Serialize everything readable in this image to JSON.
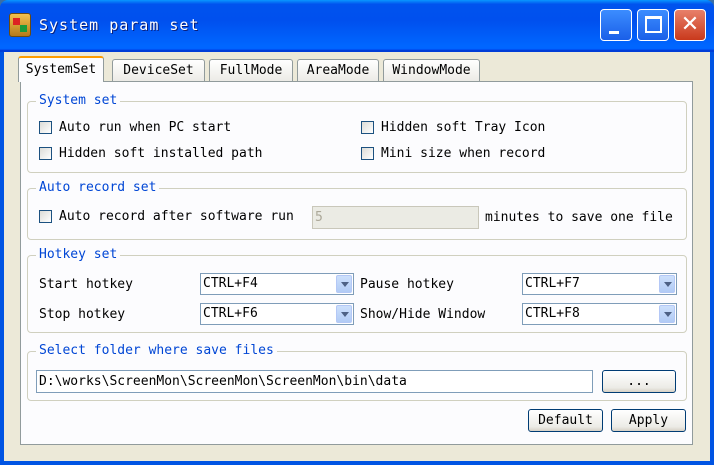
{
  "window": {
    "title": "System param set",
    "controls": {
      "minimize": "minimize",
      "maximize": "maximize",
      "close": "✕"
    }
  },
  "tabs": [
    {
      "label": "SystemSet",
      "active": true
    },
    {
      "label": "DeviceSet",
      "active": false
    },
    {
      "label": "FullMode",
      "active": false
    },
    {
      "label": "AreaMode",
      "active": false
    },
    {
      "label": "WindowMode",
      "active": false
    }
  ],
  "system_set": {
    "label": "System set",
    "auto_run": {
      "label": "Auto run when PC start",
      "checked": false
    },
    "hidden_tray": {
      "label": "Hidden soft Tray Icon",
      "checked": false
    },
    "hidden_path": {
      "label": "Hidden soft installed path",
      "checked": false
    },
    "mini_size": {
      "label": "Mini size when record",
      "checked": false
    }
  },
  "auto_record": {
    "label": "Auto record set",
    "checkbox": {
      "label": "Auto record after software run",
      "checked": false
    },
    "minutes_value": "5",
    "minutes_suffix": "minutes to save one file"
  },
  "hotkey": {
    "label": "Hotkey set",
    "start": {
      "label": "Start hotkey",
      "value": "CTRL+F4"
    },
    "pause": {
      "label": "Pause hotkey",
      "value": "CTRL+F7"
    },
    "stop": {
      "label": "Stop hotkey",
      "value": "CTRL+F6"
    },
    "showhide": {
      "label": "Show/Hide Window",
      "value": "CTRL+F8"
    }
  },
  "folder": {
    "label": "Select folder where save files",
    "path": "D:\\works\\ScreenMon\\ScreenMon\\ScreenMon\\bin\\data",
    "browse_label": "..."
  },
  "buttons": {
    "default": "Default",
    "apply": "Apply"
  },
  "colors": {
    "titlebar": "#0054e3",
    "dialog_bg": "#ece9d8",
    "group_label": "#0046d5",
    "tab_highlight": "#ff9c00",
    "close_button": "#c9391c"
  },
  "icons": {
    "app": "app-icon",
    "minimize": "minimize-icon",
    "maximize": "maximize-icon",
    "close": "close-icon"
  }
}
